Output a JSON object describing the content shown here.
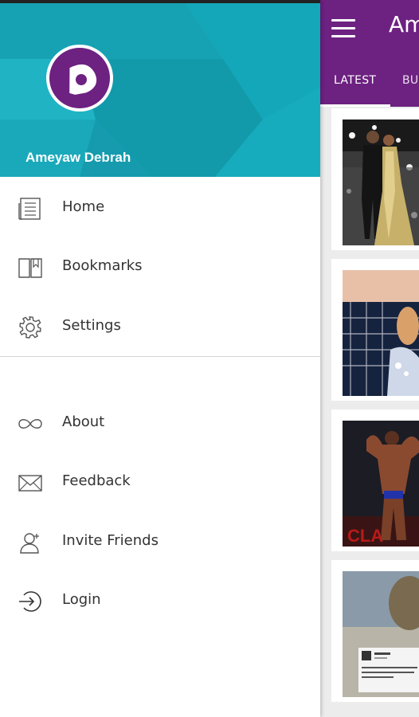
{
  "app": {
    "title": "Ameyaw",
    "tabs": [
      {
        "label": "LATEST",
        "active": true
      },
      {
        "label": "BU",
        "active": false
      }
    ],
    "colors": {
      "appbar": "#6d2181",
      "background": "#ececec"
    }
  },
  "drawer": {
    "user_name": "Ameyaw Debrah",
    "header_color": "#1fb3c4",
    "avatar_icon": "ameyaw-logo-icon",
    "primary_items": [
      {
        "label": "Home",
        "icon": "newspaper-icon"
      },
      {
        "label": "Bookmarks",
        "icon": "book-icon"
      },
      {
        "label": "Settings",
        "icon": "gear-icon"
      }
    ],
    "secondary_items": [
      {
        "label": "About",
        "icon": "infinity-icon"
      },
      {
        "label": "Feedback",
        "icon": "envelope-icon"
      },
      {
        "label": "Invite Friends",
        "icon": "add-person-icon"
      },
      {
        "label": "Login",
        "icon": "login-icon"
      }
    ]
  },
  "cards": [
    {
      "image": "red-carpet-couple-photo"
    },
    {
      "image": "woman-with-microphone-photo"
    },
    {
      "image": "bodybuilder-on-stage-photo"
    },
    {
      "image": "tweet-screenshot-photo",
      "tweet_text": "Went to buy lunch and\nstopping for me at a ..."
    }
  ]
}
